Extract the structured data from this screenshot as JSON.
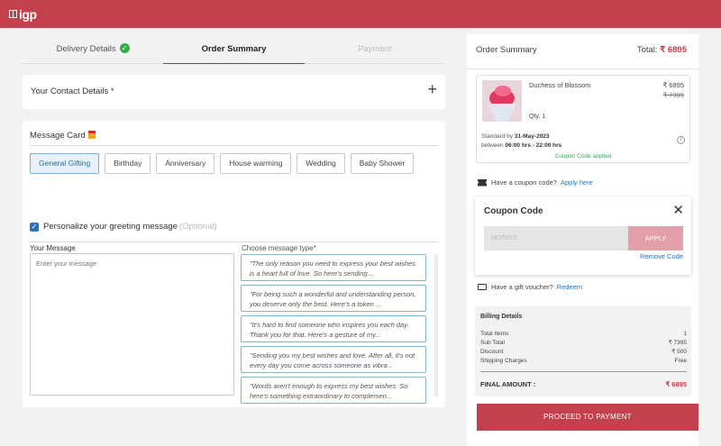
{
  "app": {
    "logo_text": "igp"
  },
  "steps": [
    {
      "label": "Delivery Details",
      "status": "done"
    },
    {
      "label": "Order Summary",
      "status": "active"
    },
    {
      "label": "Payment",
      "status": "disabled"
    }
  ],
  "contact": {
    "title": "Your Contact Details *",
    "expand_icon": "+"
  },
  "message_card": {
    "title": "Message Card",
    "occasions": [
      "General Gifting",
      "Birthday",
      "Anniversary",
      "House warming",
      "Wedding",
      "Baby Shower"
    ],
    "selected_occasion": "General Gifting",
    "personalize_label": "Personalize your greeting message",
    "personalize_optional": "(Optional)",
    "personalize_checked": true,
    "your_message_label": "Your Message",
    "message_placeholder": "Enter your message",
    "choose_type_label": "Choose message type*",
    "messages": [
      "\"The only reason you need to express your best wishes is a heart full of love. So here's sending...",
      "\"For being such a wonderful and understanding person, you deserve only the best. Here's a token ...",
      "\"It's hard to find someone who inspires you each day. Thank you for that. Here's a gesture of my...",
      "\"Sending you my best wishes and love. After all, it's not every day you come across someone as vibra...",
      "\"Words aren't enough to express my best wishes. So here's something extraordinary to complemen..."
    ]
  },
  "summary": {
    "title": "Order Summary",
    "total_label": "Total:",
    "total_value": "₹ 6895",
    "product": {
      "name": "Duchess of Blossom",
      "price": "₹ 6895",
      "original_price": "₹ 7395",
      "qty": "Qty. 1",
      "delivery_prefix": "Standard by",
      "delivery_date": "31-May-2023",
      "delivery_between": "between",
      "delivery_window": "06:00 hrs - 22:00 hrs",
      "coupon_status": "Coupon Code applied"
    },
    "coupon_prompt": "Have a coupon code?",
    "coupon_link": "Apply here",
    "coupon_box": {
      "title": "Coupon Code",
      "code_value": "MOTO15",
      "apply_label": "APPLY",
      "remove_label": "Remove Code"
    },
    "voucher_prompt": "Have a gift voucher?",
    "voucher_link": "Redeem",
    "billing": {
      "title": "Billing Details",
      "rows": [
        {
          "label": "Total Items",
          "value": "1"
        },
        {
          "label": "Sub Total",
          "value": "₹ 7395"
        },
        {
          "label": "Discount",
          "value": "₹ 500"
        },
        {
          "label": "Shipping Charges",
          "value": "Free"
        }
      ],
      "final_label": "FINAL AMOUNT :",
      "final_value": "₹ 6895"
    },
    "proceed_label": "PROCEED TO PAYMENT"
  },
  "colors": {
    "brand": "#c2414d",
    "success": "#2fae4a",
    "link": "#2a72b5"
  }
}
